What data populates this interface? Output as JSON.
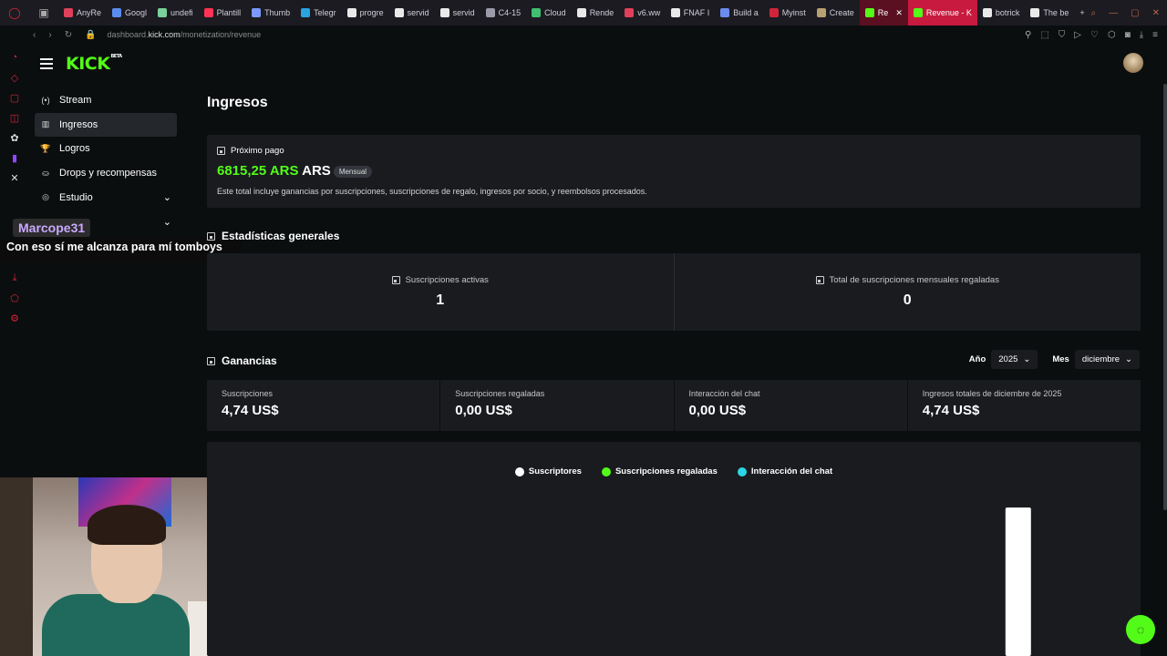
{
  "browser": {
    "tabs": [
      {
        "label": "AnyRe",
        "color": "#e0405a"
      },
      {
        "label": "Googl",
        "color": "#5b8df0"
      },
      {
        "label": "undefi",
        "color": "#7ad19a"
      },
      {
        "label": "Plantill",
        "color": "#ff3355"
      },
      {
        "label": "Thumb",
        "color": "#7a9aff"
      },
      {
        "label": "Telegr",
        "color": "#2aa3e0"
      },
      {
        "label": "progre",
        "color": "#e9e9e9"
      },
      {
        "label": "servid",
        "color": "#e9e9e9"
      },
      {
        "label": "servid",
        "color": "#e9e9e9"
      },
      {
        "label": "C4-15",
        "color": "#9a9aa8"
      },
      {
        "label": "Cloud",
        "color": "#40c070"
      },
      {
        "label": "Rende",
        "color": "#e9e9e9"
      },
      {
        "label": "v6.ww",
        "color": "#e0405a"
      },
      {
        "label": "FNAF I",
        "color": "#e9e9e9"
      },
      {
        "label": "Build a",
        "color": "#6b8bf0"
      },
      {
        "label": "Myinst",
        "color": "#d0243a"
      },
      {
        "label": "Create",
        "color": "#b8a070"
      },
      {
        "label": "Re",
        "color": "#53fc18",
        "state": "active"
      },
      {
        "label": "Revenue - K",
        "color": "#53fc18",
        "state": "hl"
      },
      {
        "label": "botrick",
        "color": "#e9e9e9"
      },
      {
        "label": "The be",
        "color": "#e9e9e9"
      }
    ],
    "url_prefix": "dashboard.",
    "url_domain": "kick.com",
    "url_path": "/monetization/revenue"
  },
  "header": {
    "logo": "KICK",
    "beta": "BETA"
  },
  "sidebar": {
    "items": [
      {
        "label": "Stream",
        "icon": "stream-icon",
        "glyph": "(•)",
        "active": false,
        "chevron": false
      },
      {
        "label": "Ingresos",
        "icon": "bar-chart-icon",
        "glyph": "▥",
        "active": true,
        "chevron": false
      },
      {
        "label": "Logros",
        "icon": "trophy-icon",
        "glyph": "🏆",
        "active": false,
        "chevron": false
      },
      {
        "label": "Drops y recompensas",
        "icon": "drops-icon",
        "glyph": "⛀",
        "active": false,
        "chevron": false
      },
      {
        "label": "Estudio",
        "icon": "studio-icon",
        "glyph": "◎",
        "active": false,
        "chevron": true
      },
      {
        "label": "",
        "icon": "",
        "glyph": "",
        "active": false,
        "chevron": true
      }
    ]
  },
  "overlay": {
    "username": "Marcope31",
    "message": "Con eso sí me alcanza para mí tomboys"
  },
  "page": {
    "title": "Ingresos",
    "payout": {
      "label": "Próximo pago",
      "amount": "6815,25 ARS",
      "currency": "ARS",
      "badge": "Mensual",
      "description": "Este total incluye ganancias por suscripciones, suscripciones de regalo, ingresos por socio, y reembolsos procesados."
    },
    "stats": {
      "heading": "Estadísticas generales",
      "items": [
        {
          "label": "Suscripciones activas",
          "value": "1"
        },
        {
          "label": "Total de suscripciones mensuales regaladas",
          "value": "0"
        }
      ]
    },
    "earnings": {
      "heading": "Ganancias",
      "year_label": "Año",
      "year_value": "2025",
      "month_label": "Mes",
      "month_value": "diciembre",
      "items": [
        {
          "label": "Suscripciones",
          "value": "4,74 US$"
        },
        {
          "label": "Suscripciones regaladas",
          "value": "0,00 US$"
        },
        {
          "label": "Interacción del chat",
          "value": "0,00 US$"
        },
        {
          "label": "Ingresos totales de diciembre de 2025",
          "value": "4,74 US$"
        }
      ]
    }
  },
  "chart_data": {
    "type": "bar",
    "legend": [
      {
        "name": "Suscriptores",
        "color": "#ffffff"
      },
      {
        "name": "Suscripciones regaladas",
        "color": "#53fc18"
      },
      {
        "name": "Interacción del chat",
        "color": "#29d6e6"
      }
    ],
    "series": [
      {
        "name": "Suscriptores",
        "bars": [
          {
            "day_index": 27,
            "value": 4.74
          }
        ]
      }
    ],
    "days_in_month": 31,
    "ymax": 4.74
  },
  "colors": {
    "brand": "#53fc18",
    "background": "#0b0e0f",
    "card": "#191b1f"
  }
}
